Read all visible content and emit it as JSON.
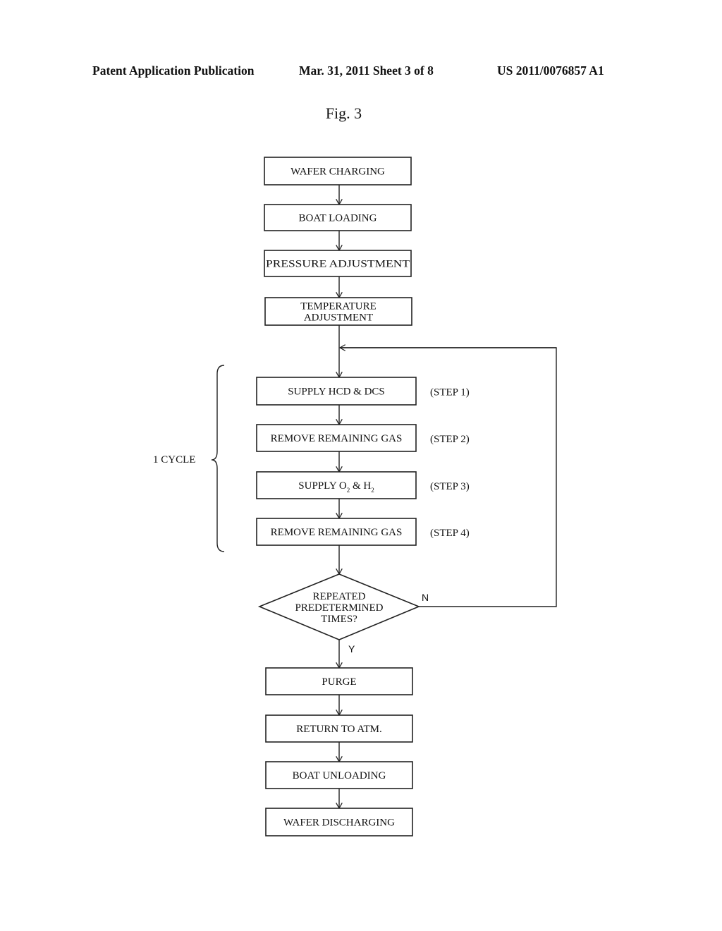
{
  "header": {
    "publication": "Patent Application Publication",
    "date_sheet": "Mar. 31, 2011  Sheet 3 of 8",
    "number": "US 2011/0076857 A1"
  },
  "figure": {
    "title": "Fig. 3",
    "cycle_label": "1 CYCLE",
    "steps": [
      {
        "id": "wafer-charging",
        "lines": [
          "WAFER CHARGING"
        ]
      },
      {
        "id": "boat-loading",
        "lines": [
          "BOAT LOADING"
        ]
      },
      {
        "id": "pressure-adjustment",
        "lines": [
          "PRESSURE ADJUSTMENT"
        ]
      },
      {
        "id": "temperature-adjustment",
        "lines": [
          "TEMPERATURE",
          "ADJUSTMENT"
        ]
      },
      {
        "id": "supply-hcd-dcs",
        "lines": [
          "SUPPLY  HCD & DCS"
        ],
        "step_label": "(STEP 1)"
      },
      {
        "id": "remove-remaining-gas-1",
        "lines": [
          "REMOVE REMAINING GAS"
        ],
        "step_label": "(STEP 2)"
      },
      {
        "id": "supply-o2-h2",
        "text_parts": [
          "SUPPLY  O",
          "2",
          " & H",
          "2"
        ],
        "step_label": "(STEP 3)"
      },
      {
        "id": "remove-remaining-gas-2",
        "lines": [
          "REMOVE REMAINING GAS"
        ],
        "step_label": "(STEP 4)"
      },
      {
        "id": "purge",
        "lines": [
          "PURGE"
        ]
      },
      {
        "id": "return-to-atm",
        "lines": [
          "RETURN TO ATM."
        ]
      },
      {
        "id": "boat-unloading",
        "lines": [
          "BOAT UNLOADING"
        ]
      },
      {
        "id": "wafer-discharging",
        "lines": [
          "WAFER DISCHARGING"
        ]
      }
    ],
    "decision": {
      "lines": [
        "REPEATED",
        "PREDETERMINED",
        "TIMES?"
      ],
      "no_label": "N",
      "yes_label": "Y"
    }
  }
}
